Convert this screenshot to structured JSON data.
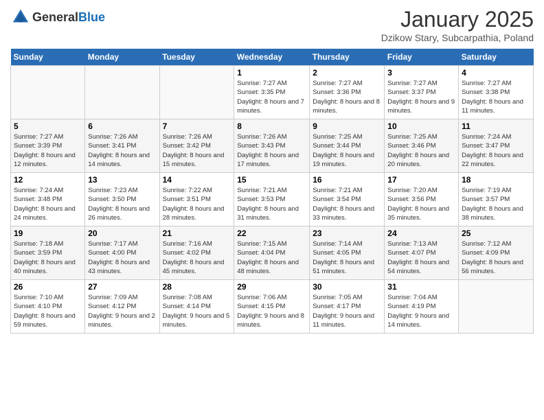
{
  "header": {
    "logo_general": "General",
    "logo_blue": "Blue",
    "month_title": "January 2025",
    "subtitle": "Dzikow Stary, Subcarpathia, Poland"
  },
  "days_of_week": [
    "Sunday",
    "Monday",
    "Tuesday",
    "Wednesday",
    "Thursday",
    "Friday",
    "Saturday"
  ],
  "weeks": [
    [
      {
        "day": "",
        "info": ""
      },
      {
        "day": "",
        "info": ""
      },
      {
        "day": "",
        "info": ""
      },
      {
        "day": "1",
        "info": "Sunrise: 7:27 AM\nSunset: 3:35 PM\nDaylight: 8 hours and 7 minutes."
      },
      {
        "day": "2",
        "info": "Sunrise: 7:27 AM\nSunset: 3:36 PM\nDaylight: 8 hours and 8 minutes."
      },
      {
        "day": "3",
        "info": "Sunrise: 7:27 AM\nSunset: 3:37 PM\nDaylight: 8 hours and 9 minutes."
      },
      {
        "day": "4",
        "info": "Sunrise: 7:27 AM\nSunset: 3:38 PM\nDaylight: 8 hours and 11 minutes."
      }
    ],
    [
      {
        "day": "5",
        "info": "Sunrise: 7:27 AM\nSunset: 3:39 PM\nDaylight: 8 hours and 12 minutes."
      },
      {
        "day": "6",
        "info": "Sunrise: 7:26 AM\nSunset: 3:41 PM\nDaylight: 8 hours and 14 minutes."
      },
      {
        "day": "7",
        "info": "Sunrise: 7:26 AM\nSunset: 3:42 PM\nDaylight: 8 hours and 15 minutes."
      },
      {
        "day": "8",
        "info": "Sunrise: 7:26 AM\nSunset: 3:43 PM\nDaylight: 8 hours and 17 minutes."
      },
      {
        "day": "9",
        "info": "Sunrise: 7:25 AM\nSunset: 3:44 PM\nDaylight: 8 hours and 19 minutes."
      },
      {
        "day": "10",
        "info": "Sunrise: 7:25 AM\nSunset: 3:46 PM\nDaylight: 8 hours and 20 minutes."
      },
      {
        "day": "11",
        "info": "Sunrise: 7:24 AM\nSunset: 3:47 PM\nDaylight: 8 hours and 22 minutes."
      }
    ],
    [
      {
        "day": "12",
        "info": "Sunrise: 7:24 AM\nSunset: 3:48 PM\nDaylight: 8 hours and 24 minutes."
      },
      {
        "day": "13",
        "info": "Sunrise: 7:23 AM\nSunset: 3:50 PM\nDaylight: 8 hours and 26 minutes."
      },
      {
        "day": "14",
        "info": "Sunrise: 7:22 AM\nSunset: 3:51 PM\nDaylight: 8 hours and 28 minutes."
      },
      {
        "day": "15",
        "info": "Sunrise: 7:21 AM\nSunset: 3:53 PM\nDaylight: 8 hours and 31 minutes."
      },
      {
        "day": "16",
        "info": "Sunrise: 7:21 AM\nSunset: 3:54 PM\nDaylight: 8 hours and 33 minutes."
      },
      {
        "day": "17",
        "info": "Sunrise: 7:20 AM\nSunset: 3:56 PM\nDaylight: 8 hours and 35 minutes."
      },
      {
        "day": "18",
        "info": "Sunrise: 7:19 AM\nSunset: 3:57 PM\nDaylight: 8 hours and 38 minutes."
      }
    ],
    [
      {
        "day": "19",
        "info": "Sunrise: 7:18 AM\nSunset: 3:59 PM\nDaylight: 8 hours and 40 minutes."
      },
      {
        "day": "20",
        "info": "Sunrise: 7:17 AM\nSunset: 4:00 PM\nDaylight: 8 hours and 43 minutes."
      },
      {
        "day": "21",
        "info": "Sunrise: 7:16 AM\nSunset: 4:02 PM\nDaylight: 8 hours and 45 minutes."
      },
      {
        "day": "22",
        "info": "Sunrise: 7:15 AM\nSunset: 4:04 PM\nDaylight: 8 hours and 48 minutes."
      },
      {
        "day": "23",
        "info": "Sunrise: 7:14 AM\nSunset: 4:05 PM\nDaylight: 8 hours and 51 minutes."
      },
      {
        "day": "24",
        "info": "Sunrise: 7:13 AM\nSunset: 4:07 PM\nDaylight: 8 hours and 54 minutes."
      },
      {
        "day": "25",
        "info": "Sunrise: 7:12 AM\nSunset: 4:09 PM\nDaylight: 8 hours and 56 minutes."
      }
    ],
    [
      {
        "day": "26",
        "info": "Sunrise: 7:10 AM\nSunset: 4:10 PM\nDaylight: 8 hours and 59 minutes."
      },
      {
        "day": "27",
        "info": "Sunrise: 7:09 AM\nSunset: 4:12 PM\nDaylight: 9 hours and 2 minutes."
      },
      {
        "day": "28",
        "info": "Sunrise: 7:08 AM\nSunset: 4:14 PM\nDaylight: 9 hours and 5 minutes."
      },
      {
        "day": "29",
        "info": "Sunrise: 7:06 AM\nSunset: 4:15 PM\nDaylight: 9 hours and 8 minutes."
      },
      {
        "day": "30",
        "info": "Sunrise: 7:05 AM\nSunset: 4:17 PM\nDaylight: 9 hours and 11 minutes."
      },
      {
        "day": "31",
        "info": "Sunrise: 7:04 AM\nSunset: 4:19 PM\nDaylight: 9 hours and 14 minutes."
      },
      {
        "day": "",
        "info": ""
      }
    ]
  ]
}
